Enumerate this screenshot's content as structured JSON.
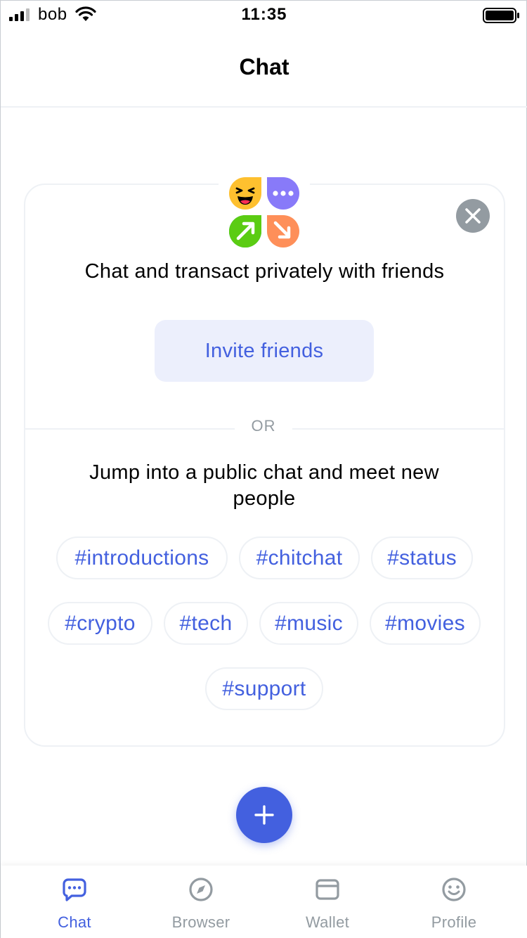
{
  "status_bar": {
    "carrier": "bob",
    "time": "11:35"
  },
  "header": {
    "title": "Chat"
  },
  "welcome_card": {
    "intro": "Chat and transact privately with friends",
    "invite_label": "Invite friends",
    "or_label": "OR",
    "public_prompt": "Jump into a public chat and meet new people",
    "tags": [
      "#introductions",
      "#chitchat",
      "#status",
      "#crypto",
      "#tech",
      "#music",
      "#movies",
      "#support"
    ]
  },
  "tabbar": {
    "tabs": [
      {
        "label": "Chat",
        "icon": "chat-icon",
        "active": true
      },
      {
        "label": "Browser",
        "icon": "compass-icon",
        "active": false
      },
      {
        "label": "Wallet",
        "icon": "wallet-icon",
        "active": false
      },
      {
        "label": "Profile",
        "icon": "smiley-icon",
        "active": false
      }
    ]
  },
  "colors": {
    "accent": "#4360df",
    "accent_light": "#eceffc",
    "muted": "#939ba1",
    "border": "#eef1f5"
  }
}
